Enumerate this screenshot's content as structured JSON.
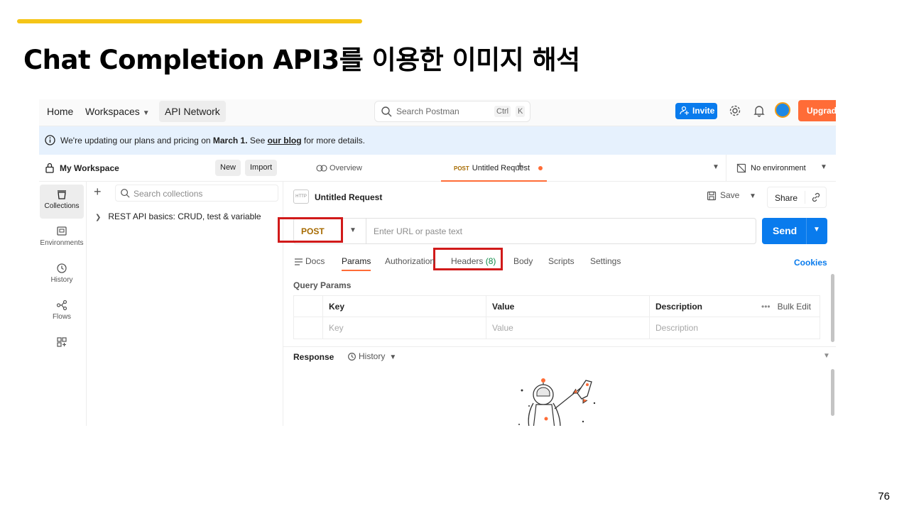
{
  "slide": {
    "title": "Chat Completion API3를 이용한 이미지 해석",
    "page_number": "76"
  },
  "topnav": {
    "home": "Home",
    "workspaces": "Workspaces",
    "api_network": "API Network",
    "search_placeholder": "Search Postman",
    "shortcut_ctrl": "Ctrl",
    "shortcut_k": "K",
    "invite": "Invite",
    "upgrade": "Upgrade"
  },
  "banner": {
    "text_before": "We're updating our plans and pricing on ",
    "date": "March 1.",
    "text_mid": " See ",
    "link": "our blog",
    "text_after": " for more details."
  },
  "sidebar": {
    "workspace_name": "My Workspace",
    "new_button": "New",
    "import_button": "Import",
    "rail": [
      {
        "label": "Collections",
        "icon": "collections-icon"
      },
      {
        "label": "Environments",
        "icon": "environments-icon"
      },
      {
        "label": "History",
        "icon": "history-icon"
      },
      {
        "label": "Flows",
        "icon": "flows-icon"
      }
    ],
    "search_placeholder": "Search collections",
    "collections": [
      "REST API basics: CRUD, test & variable"
    ]
  },
  "tabs": {
    "overview": "Overview",
    "active_method": "POST",
    "active_title": "Untitled Request",
    "environment": "No environment"
  },
  "request": {
    "icon_text": "HTTP",
    "title": "Untitled Request",
    "save": "Save",
    "share": "Share",
    "method": "POST",
    "url_placeholder": "Enter URL or paste text",
    "send": "Send",
    "tabs": {
      "docs": "Docs",
      "params": "Params",
      "authorization": "Authorization",
      "headers": "Headers",
      "headers_count": "(8)",
      "body": "Body",
      "scripts": "Scripts",
      "settings": "Settings"
    },
    "cookies": "Cookies",
    "query_params_label": "Query Params",
    "table_headers": [
      "Key",
      "Value",
      "Description"
    ],
    "table_placeholders": [
      "Key",
      "Value",
      "Description"
    ],
    "bulk_edit": "Bulk Edit"
  },
  "response": {
    "label": "Response",
    "history": "History"
  },
  "colors": {
    "accent_orange": "#ff6c37",
    "primary_blue": "#097bed",
    "highlight_red": "#d11a1a",
    "slide_bar": "#f5c518"
  }
}
